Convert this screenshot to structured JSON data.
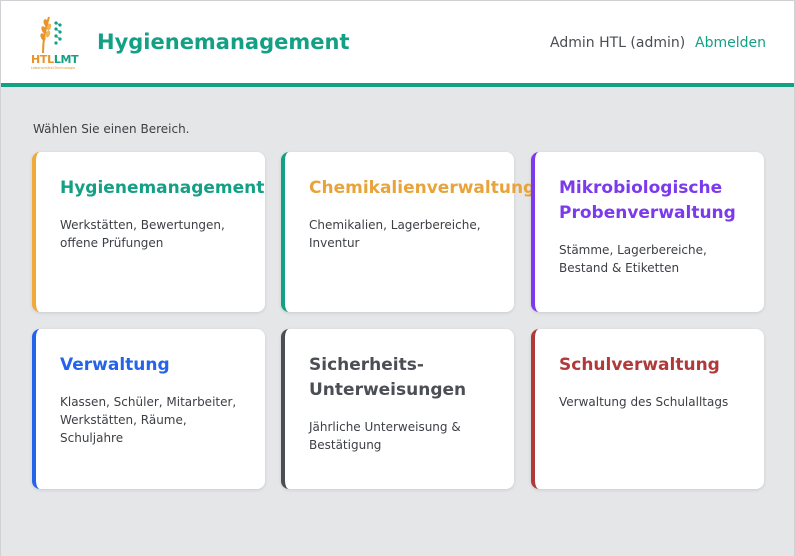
{
  "header": {
    "logo": {
      "text_left": "HTL",
      "text_right": "LMT",
      "subtitle": "Lebensmittel-Technologie"
    },
    "title": "Hygienemanagement",
    "user": "Admin HTL (admin)",
    "logout_label": "Abmelden"
  },
  "main": {
    "intro": "Wählen Sie einen Bereich.",
    "cards": [
      {
        "title": "Hygienemanagement",
        "description": "Werkstätten, Bewertungen, offene Prüfungen",
        "accent": "#f2a93b",
        "title_color": "#14a085"
      },
      {
        "title": "Chemikalienverwaltung",
        "description": "Chemikalien, Lagerbereiche, Inventur",
        "accent": "#14a085",
        "title_color": "#e8a43a"
      },
      {
        "title": "Mikrobiologische Probenverwaltung",
        "description": "Stämme, Lagerbereiche, Bestand & Etiketten",
        "accent": "#7c3aed",
        "title_color": "#7c3aed"
      },
      {
        "title": "Verwaltung",
        "description": "Klassen, Schüler, Mitarbeiter, Werkstätten, Räume, Schuljahre",
        "accent": "#2563eb",
        "title_color": "#2563eb"
      },
      {
        "title": "Sicherheits-Unterweisungen",
        "description": "Jährliche Unterweisung & Bestätigung",
        "accent": "#4b4f55",
        "title_color": "#4b4f55"
      },
      {
        "title": "Schulverwaltung",
        "description": "Verwaltung des Schulalltags",
        "accent": "#b03a3a",
        "title_color": "#b03a3a"
      }
    ]
  }
}
